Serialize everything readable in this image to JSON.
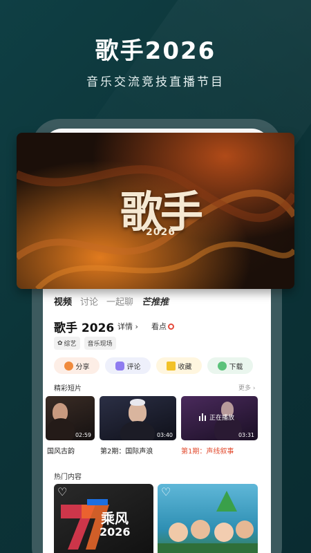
{
  "promo": {
    "title": "歌手2026",
    "subtitle": "音乐交流竞技直播节目"
  },
  "hero": {
    "logo_text": "歌手",
    "logo_year": "2026"
  },
  "tabs": [
    {
      "label": "视频",
      "active": true
    },
    {
      "label": "讨论",
      "active": false
    },
    {
      "label": "一起聊",
      "active": false
    },
    {
      "label": "芒推推",
      "active": false
    }
  ],
  "show": {
    "title": "歌手 2026",
    "details_label": "详情 ›",
    "watch_label": "看点",
    "chips": [
      "综艺",
      "音乐现场"
    ]
  },
  "actions": [
    {
      "label": "分享",
      "icon": "share-icon"
    },
    {
      "label": "评论",
      "icon": "comment-icon"
    },
    {
      "label": "收藏",
      "icon": "favorite-icon"
    },
    {
      "label": "下载",
      "icon": "download-icon"
    }
  ],
  "clips_section": {
    "title": "精彩短片",
    "more_label": "更多 ›",
    "items": [
      {
        "label": "国风古韵",
        "duration": "02:59",
        "playing": false
      },
      {
        "label": "第2期：国际声浪",
        "duration": "03:40",
        "playing": false
      },
      {
        "label": "第1期：声线叙事",
        "duration": "03:31",
        "playing": true,
        "playing_text": "正在播放"
      }
    ]
  },
  "hot_section": {
    "title": "热门内容",
    "cards": [
      {
        "badge_text": "乘风",
        "year_text": "2026"
      },
      {
        "badge_text": ""
      }
    ]
  },
  "colors": {
    "background": "#0c3438",
    "playing_accent": "#e24a2d"
  }
}
